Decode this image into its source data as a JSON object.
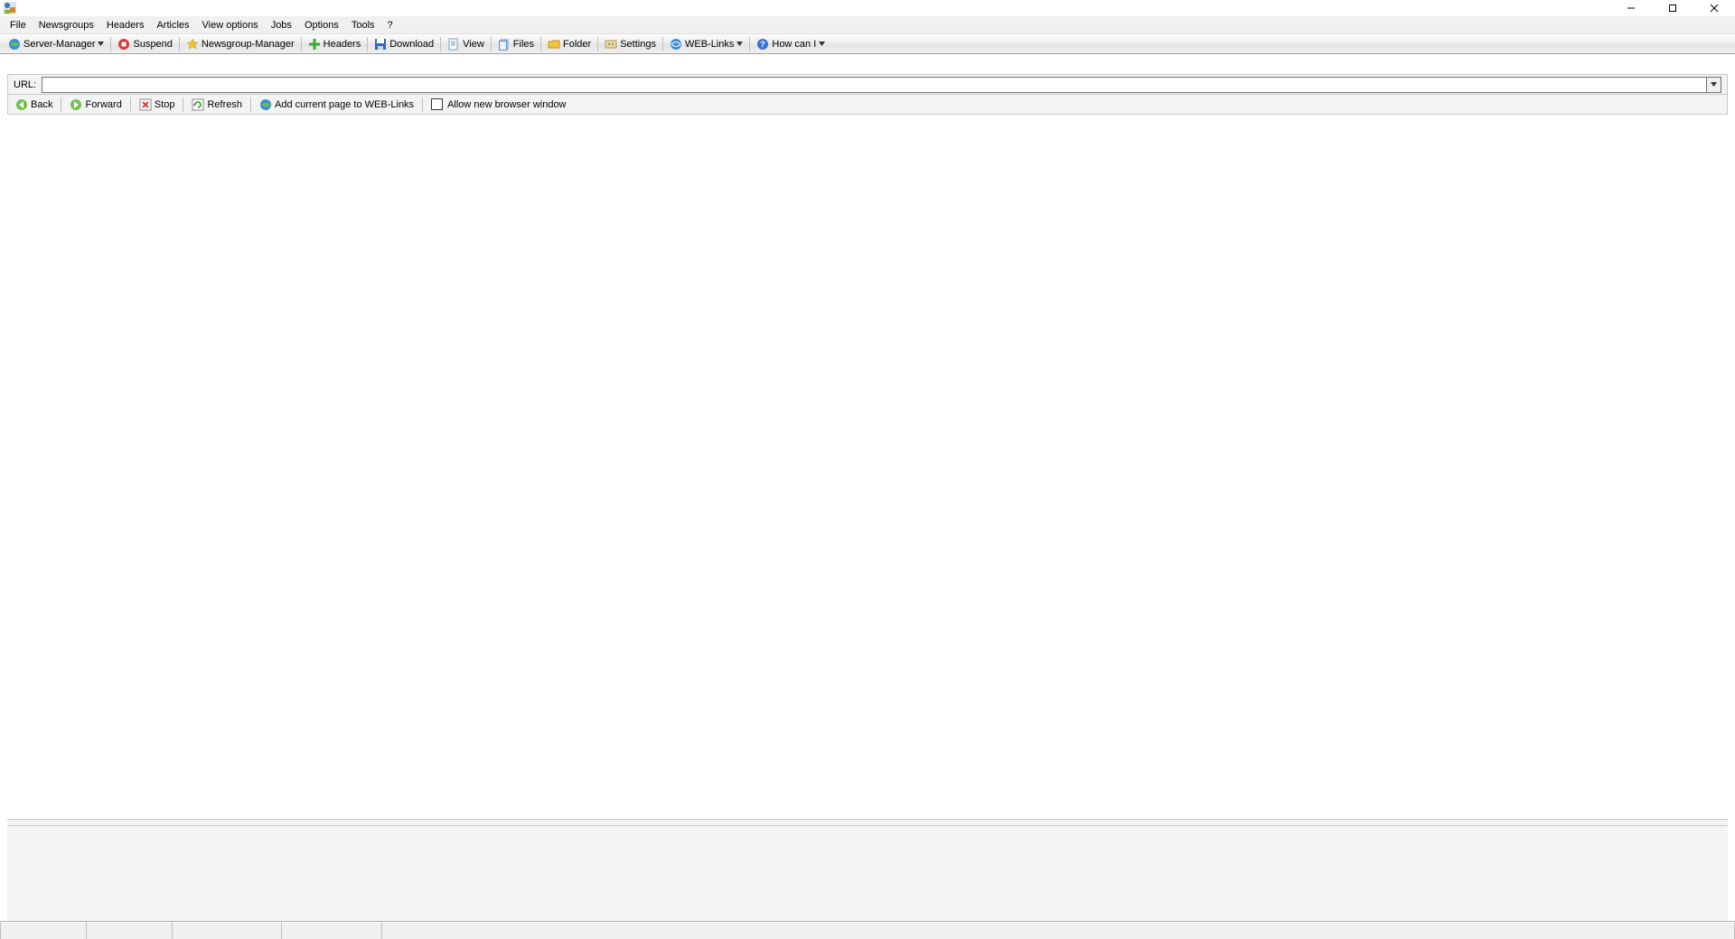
{
  "menubar": {
    "items": [
      "File",
      "Newsgroups",
      "Headers",
      "Articles",
      "View options",
      "Jobs",
      "Options",
      "Tools",
      "?"
    ]
  },
  "toolbar": {
    "server_manager": "Server-Manager",
    "suspend": "Suspend",
    "newsgroup_manager": "Newsgroup-Manager",
    "headers": "Headers",
    "download": "Download",
    "view": "View",
    "files": "Files",
    "folder": "Folder",
    "settings": "Settings",
    "web_links": "WEB-Links",
    "how_can_i": "How can I"
  },
  "urlbar": {
    "label": "URL:",
    "value": ""
  },
  "browser_toolbar": {
    "back": "Back",
    "forward": "Forward",
    "stop": "Stop",
    "refresh": "Refresh",
    "add_page": "Add current page to WEB-Links",
    "allow_new_window": "Allow new browser window",
    "allow_checked": false
  }
}
